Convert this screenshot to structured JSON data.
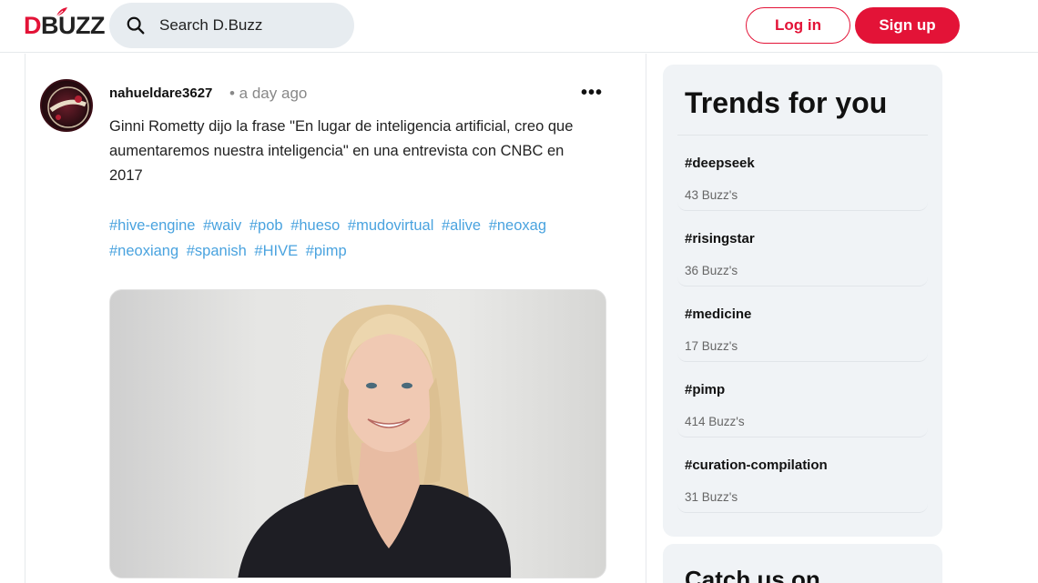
{
  "header": {
    "logo_d": "D",
    "logo_rest": "BUZZ",
    "search_placeholder": "Search D.Buzz",
    "login_label": "Log in",
    "signup_label": "Sign up"
  },
  "post": {
    "username": "nahueldare3627",
    "timestamp": "• a day ago",
    "more_label": "•••",
    "text": "Ginni Rometty dijo la frase \"En lugar de inteligencia artificial, creo que aumentaremos nuestra inteligencia\" en una entrevista con CNBC en 2017",
    "tags": [
      "#hive-engine",
      "#waiv",
      "#pob",
      "#hueso",
      "#mudovirtual",
      "#alive",
      "#neoxag",
      "#neoxiang",
      "#spanish",
      "#HIVE",
      "#pimp"
    ]
  },
  "trends": {
    "title": "Trends for you",
    "items": [
      {
        "tag": "#deepseek",
        "count": "43 Buzz's"
      },
      {
        "tag": "#risingstar",
        "count": "36 Buzz's"
      },
      {
        "tag": "#medicine",
        "count": "17 Buzz's"
      },
      {
        "tag": "#pimp",
        "count": "414 Buzz's"
      },
      {
        "tag": "#curation-compilation",
        "count": "31 Buzz's"
      }
    ]
  },
  "catch": {
    "title": "Catch us on"
  },
  "colors": {
    "brand": "#e31337",
    "link": "#4aa3df",
    "panel": "#f0f3f6"
  }
}
